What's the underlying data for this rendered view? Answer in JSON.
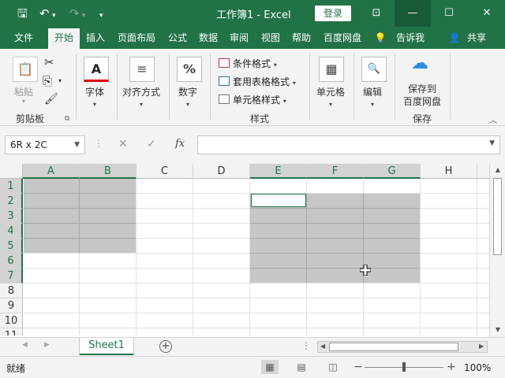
{
  "titlebar": {
    "title": "工作簿1  -  Excel",
    "login": "登录",
    "save_glyph": "🖫",
    "undo_glyph": "↶",
    "redo_glyph": "↷",
    "customize_glyph": "▾",
    "ribbon_opts_glyph": "⊡",
    "min_glyph": "—",
    "max_glyph": "☐",
    "close_glyph": "✕"
  },
  "menu": {
    "items": [
      "文件",
      "开始",
      "插入",
      "页面布局",
      "公式",
      "数据",
      "审阅",
      "视图",
      "帮助",
      "百度网盘",
      "告诉我",
      "共享"
    ],
    "active": "开始",
    "tellme_glyph": "💡",
    "share_glyph": "👤"
  },
  "ribbon": {
    "clipboard": {
      "paste": "粘贴",
      "group": "剪贴板",
      "cut_glyph": "✂",
      "copy_glyph": "⎘",
      "brush_glyph": "🖌",
      "launcher_glyph": "⧉"
    },
    "font": {
      "label": "字体",
      "icon_glyph": "A"
    },
    "alignment": {
      "label": "对齐方式",
      "icon_glyph": "≡"
    },
    "number": {
      "label": "数字",
      "icon_glyph": "%"
    },
    "styles": {
      "conditional": "条件格式",
      "table": "套用表格格式",
      "cell": "单元格样式",
      "group": "样式"
    },
    "cells": {
      "label": "单元格",
      "icon_glyph": "▦"
    },
    "editing": {
      "label": "编辑",
      "icon_glyph": "🔍"
    },
    "baidu": {
      "line1": "保存到",
      "line2": "百度网盘",
      "group": "保存",
      "icon_glyph": "☁"
    },
    "collapse_glyph": "︿"
  },
  "formula": {
    "namebox": "6R x 2C",
    "cancel_glyph": "✕",
    "enter_glyph": "✓",
    "fx": "fx",
    "dropdown_glyph": "⌄",
    "more_glyph": "⋮",
    "value": ""
  },
  "grid": {
    "columns": [
      "A",
      "B",
      "C",
      "D",
      "E",
      "F",
      "G",
      "H"
    ],
    "rows": [
      "1",
      "2",
      "3",
      "4",
      "5",
      "6",
      "7",
      "8",
      "9",
      "10",
      "11"
    ],
    "selected_columns": [
      "A",
      "B",
      "E",
      "F",
      "G"
    ],
    "selected_rows": [
      "1",
      "2",
      "3",
      "4",
      "5",
      "6",
      "7"
    ]
  },
  "tabs": {
    "sheet": "Sheet1",
    "add_glyph": "+",
    "prev_glyph": "◀",
    "next_glyph": "▶",
    "more_glyph": "⋮"
  },
  "status": {
    "ready": "就绪",
    "zoom": "100%",
    "zoom_minus": "−",
    "zoom_plus": "+",
    "normal_glyph": "▦",
    "layout_glyph": "▤",
    "pagebreak_glyph": "◫"
  },
  "colors": {
    "accent": "#217346",
    "selection": "#c6c6c6"
  }
}
